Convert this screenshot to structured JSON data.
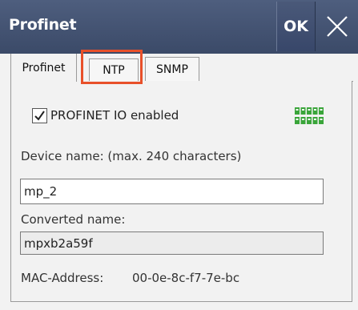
{
  "window": {
    "title": "Profinet",
    "ok_label": "OK",
    "close_icon": "close-icon"
  },
  "tabs": [
    {
      "label": "Profinet",
      "active": true
    },
    {
      "label": "NTP",
      "active": false,
      "highlighted": true
    },
    {
      "label": "SNMP",
      "active": false
    }
  ],
  "profinet": {
    "io_enabled_label": "PROFINET IO enabled",
    "io_enabled": true,
    "logo_icon": "profinet-logo",
    "device_name_label": "Device name: (max. 240 characters)",
    "device_name_value": "mp_2",
    "converted_name_label": "Converted name:",
    "converted_name_value": "mpxb2a59f",
    "mac_label": "MAC-Address:",
    "mac_value": "00-0e-8c-f7-7e-bc"
  },
  "colors": {
    "titlebar": "#3f4e6e",
    "highlight": "#e8502a",
    "logo_green": "#3aa53a"
  }
}
